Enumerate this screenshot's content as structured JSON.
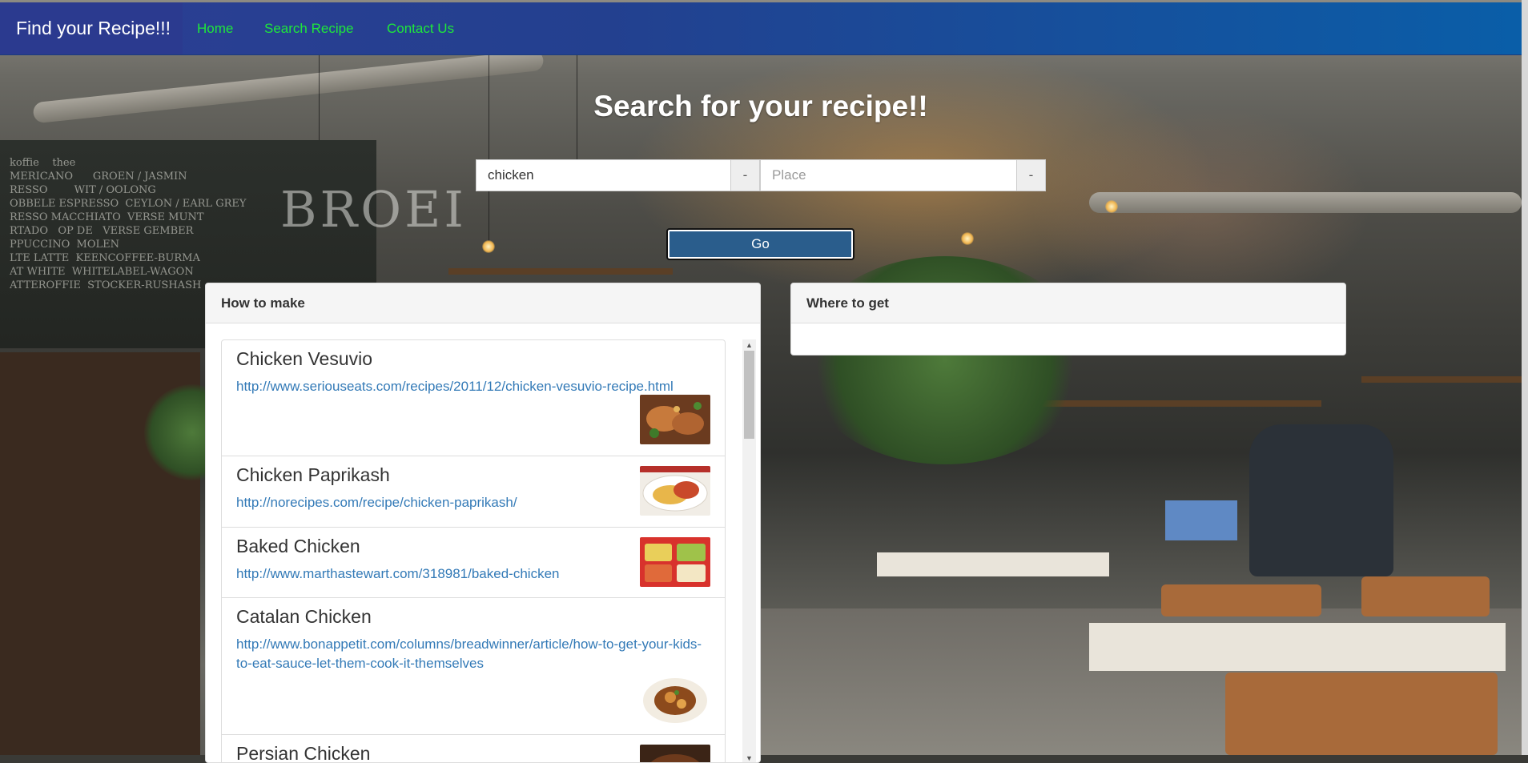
{
  "navbar": {
    "brand": "Find your Recipe!!!",
    "links": [
      "Home",
      "Search Recipe",
      "Contact Us"
    ]
  },
  "search": {
    "heading": "Search for your recipe!!",
    "recipe_value": "chicken",
    "recipe_addon": "-",
    "place_placeholder": "Place",
    "place_value": "",
    "place_addon": "-",
    "go_label": "Go"
  },
  "how_panel": {
    "title": "How to make",
    "items": [
      {
        "title": "Chicken Vesuvio",
        "url": "http://www.seriouseats.com/recipes/2011/12/chicken-vesuvio-recipe.html",
        "thumb": "roast-chicken-image"
      },
      {
        "title": "Chicken Paprikash",
        "url": "http://norecipes.com/recipe/chicken-paprikash/",
        "thumb": "paprikash-image"
      },
      {
        "title": "Baked Chicken",
        "url": "http://www.marthastewart.com/318981/baked-chicken",
        "thumb": "tray-meal-image"
      },
      {
        "title": "Catalan Chicken",
        "url": "http://www.bonappetit.com/columns/breadwinner/article/how-to-get-your-kids-to-eat-sauce-let-them-cook-it-themselves",
        "thumb": "bowl-image"
      },
      {
        "title": "Persian Chicken",
        "url": "",
        "thumb": "stew-image"
      }
    ]
  },
  "where_panel": {
    "title": "Where to get"
  },
  "background": {
    "board_text": "koffie    thee\nMERICANO      GROEN / JASMIN\nRESSO        WIT / OOLONG\nOBBELE ESPRESSO  CEYLON / EARL GREY\nRESSO MACCHIATO  VERSE MUNT\nRTADO   OP DE   VERSE GEMBER\nPPUCCINO  MOLEN\nLTE LATTE  KEENCOFFEE-BURMA\nAT WHITE  WHITELABEL-WAGON\nATTEROFFIE  STOCKER-RUSHASH",
    "sign": "BROEI"
  },
  "colors": {
    "navbar": "#23408f",
    "nav_link": "#1ee83a",
    "go_button": "#2a5d8c",
    "link": "#337ab7"
  }
}
